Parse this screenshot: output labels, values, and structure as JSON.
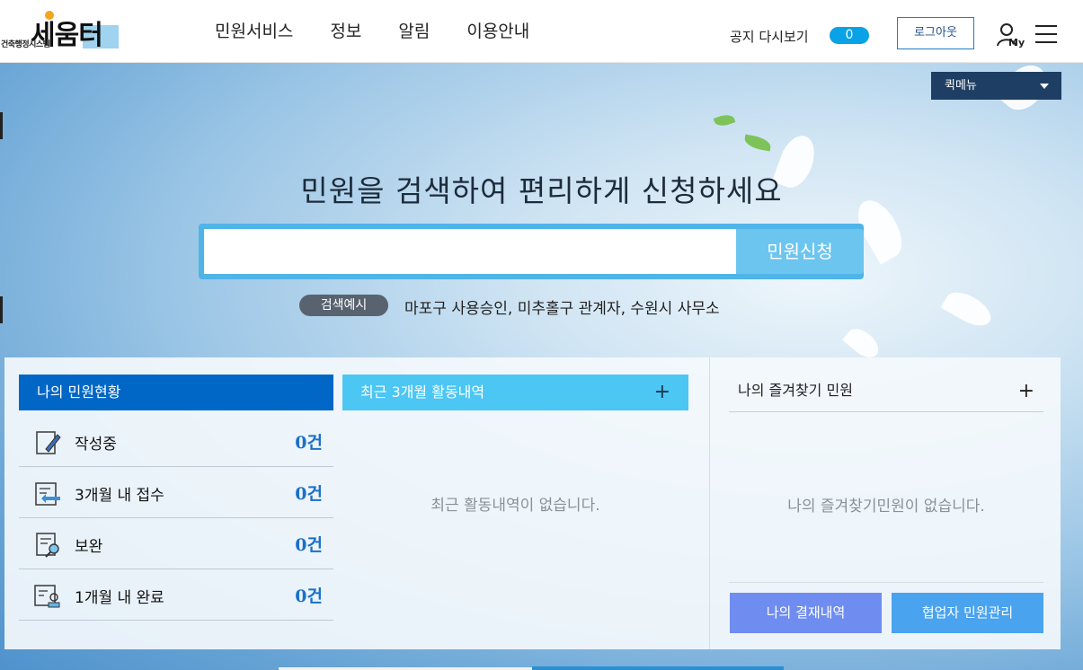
{
  "header": {
    "logo_text": "세움터",
    "logo_sub": "건축행정시스템",
    "nav": [
      "민원서비스",
      "정보",
      "알림",
      "이용안내"
    ],
    "notice_label": "공지 다시보기",
    "notice_count": "0",
    "logout_label": "로그아웃",
    "my_label": "My"
  },
  "quick_menu": {
    "label": "퀵메뉴"
  },
  "hero": {
    "headline": "민원을 검색하여 편리하게 신청하세요",
    "search_placeholder": "",
    "search_button": "민원신청",
    "example_tag": "검색예시",
    "example_text": "마포구 사용승인, 미추홀구 관계자, 수원시 사무소"
  },
  "my_status": {
    "title": "나의 민원현황",
    "rows": [
      {
        "label": "작성중",
        "count": "0건",
        "icon": "pencil-document-icon"
      },
      {
        "label": "3개월 내 접수",
        "count": "0건",
        "icon": "document-arrow-icon"
      },
      {
        "label": "보완",
        "count": "0건",
        "icon": "document-search-icon"
      },
      {
        "label": "1개월 내 완료",
        "count": "0건",
        "icon": "certificate-stamp-icon"
      }
    ]
  },
  "recent": {
    "title": "최근 3개월 활동내역",
    "plus": "+",
    "empty": "최근 활동내역이 없습니다."
  },
  "favorites": {
    "title": "나의 즐겨찾기 민원",
    "plus": "+",
    "empty": "나의 즐겨찾기민원이 없습니다.",
    "btn_payment": "나의 결재내역",
    "btn_collab": "협업자 민원관리"
  },
  "colors": {
    "primary_blue": "#0067c6",
    "sky_blue": "#4cc6f3",
    "navy": "#1e3f63",
    "count_blue": "#1a6fc9"
  }
}
